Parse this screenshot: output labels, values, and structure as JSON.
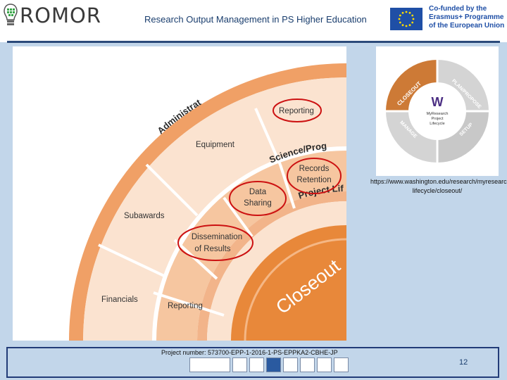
{
  "header": {
    "logo_text": "ROMOR",
    "title": "Research Output Management in PS Higher Education",
    "eu_lines": [
      "Co-funded by the",
      "Erasmus+ Programme",
      "of the European Union"
    ]
  },
  "figure": {
    "band_labels": [
      "Administrat",
      "Science/Prog",
      "Project Lif"
    ],
    "closeout_label": "Closeout",
    "outer_items": [
      "Reporting",
      "Equipment",
      "Subawards",
      "Financials"
    ],
    "inner_items": [
      "Records Retention",
      "Data Sharing",
      "Dissemination of Results",
      "Reporting"
    ]
  },
  "lifecycle": {
    "segments": [
      "CLOSEOUT",
      "PLAN/PROPOSE",
      "SETUP",
      "MANAGE"
    ],
    "center_mark": "W",
    "center_lines": [
      "MyResearch",
      "Project",
      "Lifecycle"
    ]
  },
  "source_url": "https://www.washington.edu/research/myresearch-lifecycle/closeout/",
  "footer": {
    "project_number": "Project number: 573700-EPP-1-2016-1-PS-EPPKA2-CBHE-JP",
    "page_number": "12"
  },
  "colors": {
    "background": "#c2d6ea",
    "accent_orange": "#f0a066",
    "closeout_orange": "#e8883a",
    "circle_red": "#cc1111",
    "eu_blue": "#1f4fa6"
  }
}
